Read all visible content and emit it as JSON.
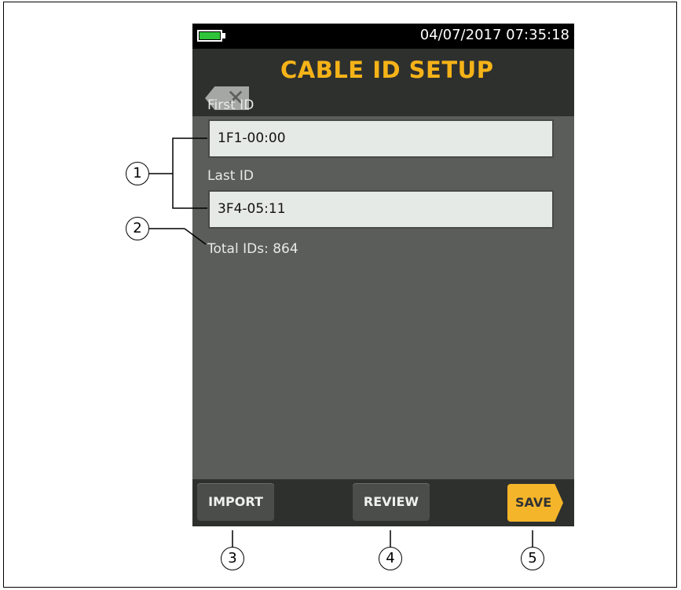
{
  "status_bar": {
    "datetime": "04/07/2017 07:35:18"
  },
  "header": {
    "title": "CABLE ID SETUP"
  },
  "form": {
    "first_id_label": "First ID",
    "first_id_value": "1F1-00:00",
    "last_id_label": "Last ID",
    "last_id_value": "3F4-05:11",
    "total_ids": "Total IDs: 864"
  },
  "toolbar": {
    "import_label": "IMPORT",
    "review_label": "REVIEW",
    "save_label": "SAVE"
  },
  "callouts": {
    "c1": "1",
    "c2": "2",
    "c3": "3",
    "c4": "4",
    "c5": "5"
  },
  "colors": {
    "accent": "#f5b318",
    "battery": "#2fc33a",
    "save": "#f5b52a"
  }
}
